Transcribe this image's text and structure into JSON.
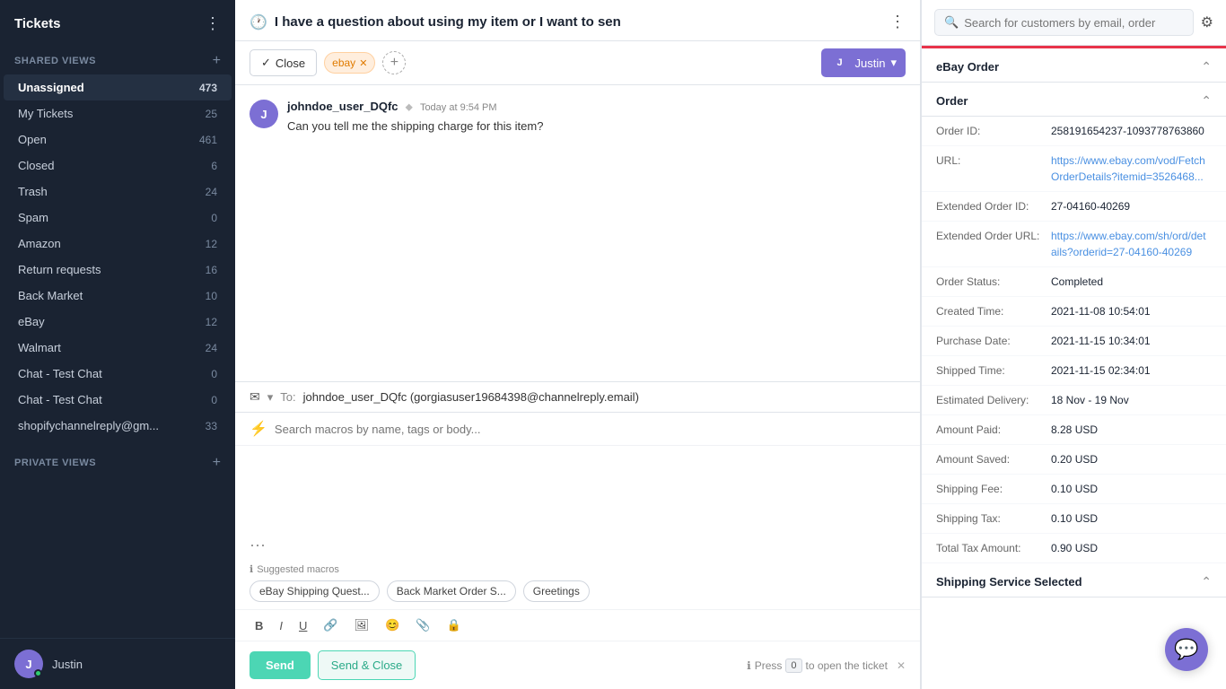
{
  "sidebar": {
    "title": "Tickets",
    "shared_views_label": "SHARED VIEWS",
    "private_views_label": "PRIVATE VIEWS",
    "items": [
      {
        "id": "unassigned",
        "label": "Unassigned",
        "count": "473",
        "active": true
      },
      {
        "id": "my-tickets",
        "label": "My Tickets",
        "count": "25",
        "active": false
      },
      {
        "id": "open",
        "label": "Open",
        "count": "461",
        "active": false
      },
      {
        "id": "closed",
        "label": "Closed",
        "count": "6",
        "active": false
      },
      {
        "id": "trash",
        "label": "Trash",
        "count": "24",
        "active": false
      },
      {
        "id": "spam",
        "label": "Spam",
        "count": "0",
        "active": false
      },
      {
        "id": "amazon",
        "label": "Amazon",
        "count": "12",
        "active": false
      },
      {
        "id": "return-requests",
        "label": "Return requests",
        "count": "16",
        "active": false
      },
      {
        "id": "back-market",
        "label": "Back Market",
        "count": "10",
        "active": false
      },
      {
        "id": "ebay",
        "label": "eBay",
        "count": "12",
        "active": false
      },
      {
        "id": "walmart",
        "label": "Walmart",
        "count": "24",
        "active": false
      },
      {
        "id": "chat-test-1",
        "label": "Chat - Test Chat",
        "count": "0",
        "active": false
      },
      {
        "id": "chat-test-2",
        "label": "Chat - Test Chat",
        "count": "0",
        "active": false
      },
      {
        "id": "shopify",
        "label": "shopifychannelreply@gm...",
        "count": "33",
        "active": false
      }
    ],
    "user": {
      "name": "Justin",
      "initial": "J"
    }
  },
  "ticket": {
    "title": "I have a question about using my item or I want to sen",
    "close_label": "Close",
    "tag": "ebay",
    "assignee": "Justin",
    "assignee_initial": "J"
  },
  "message": {
    "sender": "johndoe_user_DQfc",
    "copy_icon": "⬥",
    "time": "Today at 9:54 PM",
    "text": "Can you tell me the shipping charge for this item?"
  },
  "reply": {
    "to_label": "To:",
    "to_address": "johndoe_user_DQfc (gorgiasuser19684398@channelreply.email)",
    "macro_placeholder": "Search macros by name, tags or body...",
    "suggested_macros_label": "Suggested macros",
    "macros": [
      {
        "label": "eBay Shipping Quest..."
      },
      {
        "label": "Back Market Order S..."
      },
      {
        "label": "Greetings"
      }
    ],
    "send_label": "Send",
    "send_close_label": "Send & Close",
    "press_label": "Press",
    "key_label": "0",
    "open_ticket_label": "to open the ticket"
  },
  "right_panel": {
    "search_placeholder": "Search for customers by email, order",
    "section_title": "eBay Order",
    "order_section_title": "Order",
    "order": {
      "order_id_label": "Order ID:",
      "order_id": "258191654237-1093778763860",
      "url_label": "URL:",
      "url_text": "https://www.ebay.com/vod/FetchOrderDetails?itemid=3526468...",
      "url_href": "#",
      "extended_order_id_label": "Extended Order ID:",
      "extended_order_id": "27-04160-40269",
      "extended_order_url_label": "Extended Order URL:",
      "extended_order_url_text": "https://www.ebay.com/sh/ord/details?orderid=27-04160-40269",
      "extended_order_url_href": "#",
      "order_status_label": "Order Status:",
      "order_status": "Completed",
      "created_time_label": "Created Time:",
      "created_time": "2021-11-08 10:54:01",
      "purchase_date_label": "Purchase Date:",
      "purchase_date": "2021-11-15 10:34:01",
      "shipped_time_label": "Shipped Time:",
      "shipped_time": "2021-11-15 02:34:01",
      "estimated_delivery_label": "Estimated Delivery:",
      "estimated_delivery": "18 Nov - 19 Nov",
      "amount_paid_label": "Amount Paid:",
      "amount_paid": "8.28 USD",
      "amount_saved_label": "Amount Saved:",
      "amount_saved": "0.20 USD",
      "shipping_fee_label": "Shipping Fee:",
      "shipping_fee": "0.10 USD",
      "shipping_tax_label": "Shipping Tax:",
      "shipping_tax": "0.10 USD",
      "total_tax_label": "Total Tax Amount:",
      "total_tax": "0.90 USD",
      "shipping_service_label": "Shipping Service Selected"
    }
  },
  "chat_widget_icon": "💬"
}
